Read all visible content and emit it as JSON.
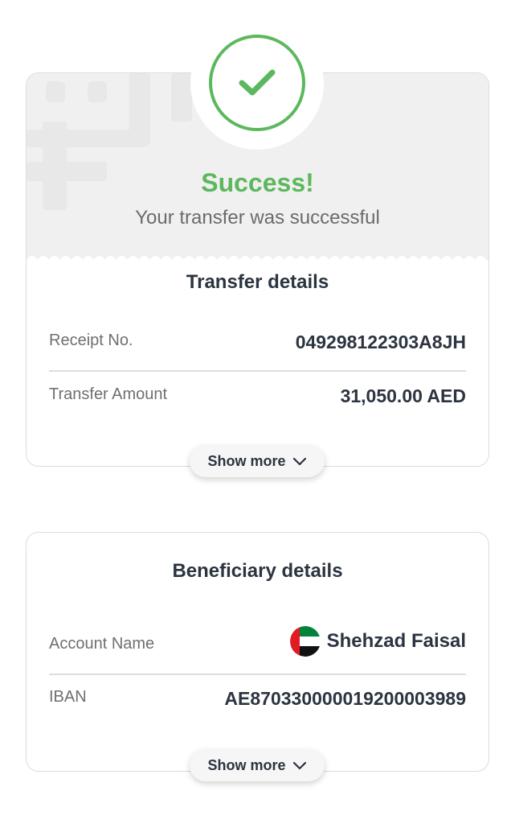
{
  "success": {
    "title": "Success!",
    "subtitle": "Your transfer was successful",
    "accent": "#5cb85c",
    "icon": "check-icon"
  },
  "transfer": {
    "title": "Transfer details",
    "rows": [
      {
        "label": "Receipt No.",
        "value": "049298122303A8JH"
      },
      {
        "label": "Transfer Amount",
        "value": "31,050.00 AED"
      }
    ],
    "show_more": "Show more"
  },
  "beneficiary": {
    "title": "Beneficiary details",
    "rows": [
      {
        "label": "Account Name",
        "value": "Shehzad Faisal",
        "flag_icon": "uae-flag-icon"
      },
      {
        "label": "IBAN",
        "value": "AE870330000019200003989"
      }
    ],
    "show_more": "Show more"
  }
}
